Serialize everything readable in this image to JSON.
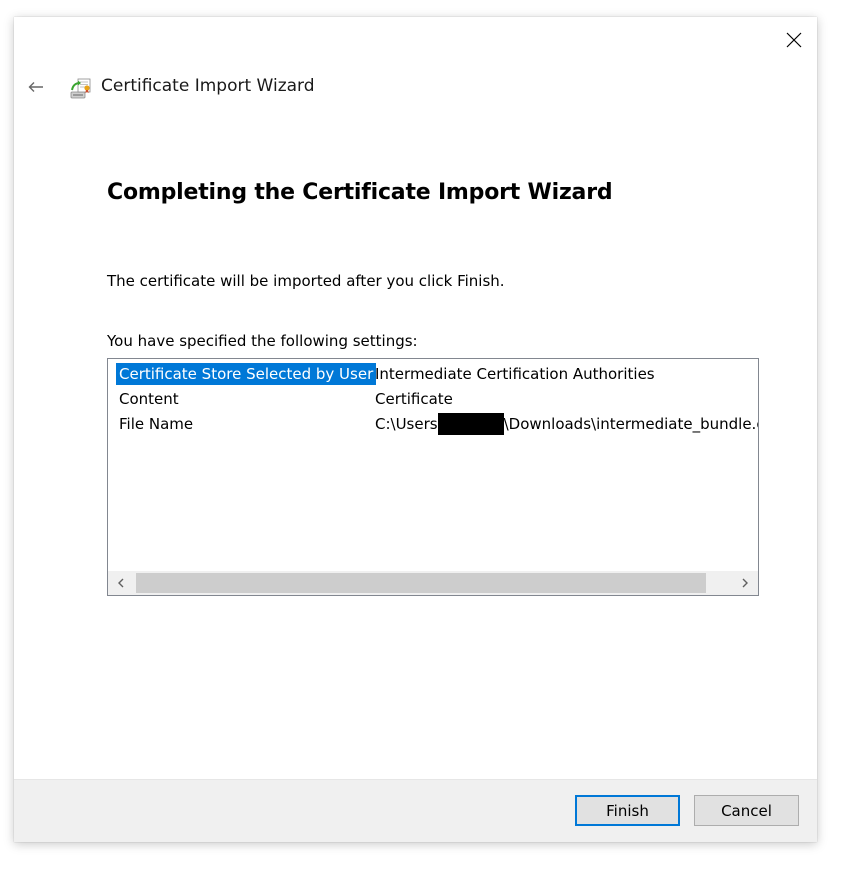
{
  "window": {
    "close_icon": "close-icon",
    "back_icon": "back-arrow-icon",
    "wizard_icon": "certificate-wizard-icon",
    "title": "Certificate Import Wizard"
  },
  "page": {
    "heading": "Completing the Certificate Import Wizard",
    "info": "The certificate will be imported after you click Finish.",
    "settings_label": "You have specified the following settings:"
  },
  "settings": {
    "rows": [
      {
        "name": "Certificate Store Selected by User",
        "value": "Intermediate Certification Authorities",
        "selected": true
      },
      {
        "name": "Content",
        "value": "Certificate",
        "selected": false
      },
      {
        "name": "File Name",
        "value_prefix": "C:\\Users",
        "value_suffix": "\\Downloads\\intermediate_bundle.ce",
        "selected": false
      }
    ],
    "scroll_left_icon": "chevron-left-icon",
    "scroll_right_icon": "chevron-right-icon"
  },
  "buttons": {
    "finish": "Finish",
    "cancel": "Cancel"
  },
  "colors": {
    "selection": "#0078d7",
    "default_button_border": "#0078d7",
    "footer_bg": "#f0f0f0"
  }
}
